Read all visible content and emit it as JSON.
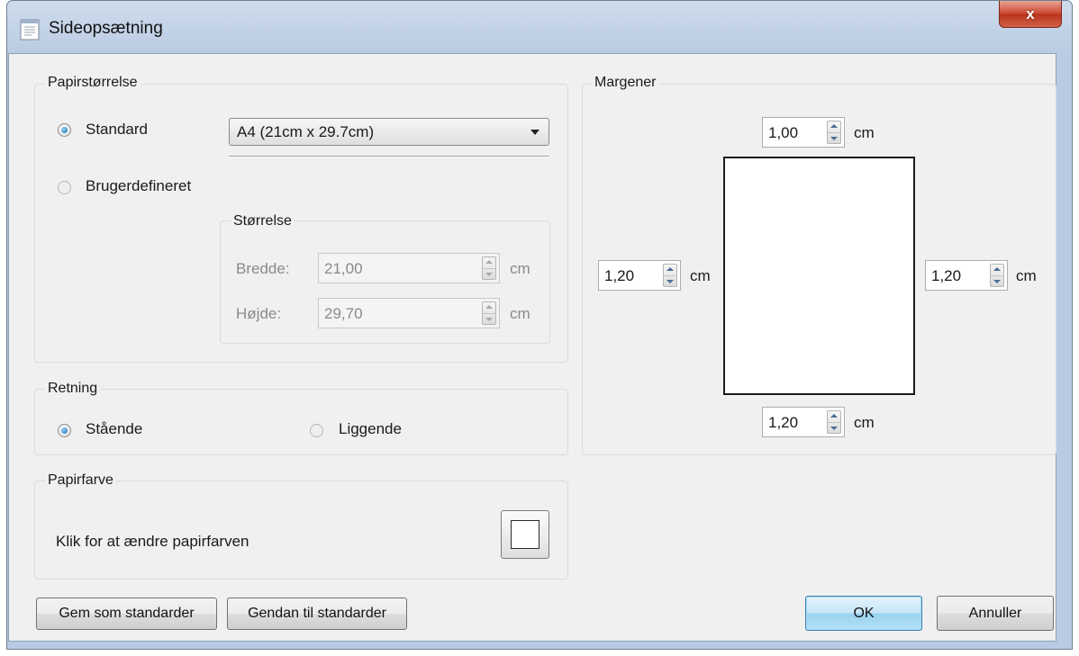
{
  "window": {
    "title": "Sideopsætning",
    "close_symbol": "x"
  },
  "paper_size": {
    "group_label": "Papirstørrelse",
    "standard_label": "Standard",
    "standard_value": "A4 (21cm x 29.7cm)",
    "custom_label": "Brugerdefineret",
    "size_group_label": "Størrelse",
    "width_label": "Bredde:",
    "width_value": "21,00",
    "height_label": "Højde:",
    "height_value": "29,70",
    "unit": "cm"
  },
  "orientation": {
    "group_label": "Retning",
    "portrait_label": "Stående",
    "landscape_label": "Liggende"
  },
  "paper_color": {
    "group_label": "Papirfarve",
    "text": "Klik for at ændre papirfarven",
    "color": "#ffffff"
  },
  "margins": {
    "group_label": "Margener",
    "top": "1,00",
    "left": "1,20",
    "right": "1,20",
    "bottom": "1,20",
    "unit": "cm"
  },
  "buttons": {
    "save_defaults": "Gem som standarder",
    "restore_defaults": "Gendan til standarder",
    "ok": "OK",
    "cancel": "Annuller"
  },
  "colors": {
    "title_bar": "#b9cbe2",
    "close_button": "#c9452e",
    "dialog_bg": "#f0f0f0",
    "default_button": "#98d1ef"
  },
  "icons": [
    "page-setup-icon",
    "close-icon",
    "dropdown-arrow-icon",
    "spin-up-icon",
    "spin-down-icon"
  ]
}
